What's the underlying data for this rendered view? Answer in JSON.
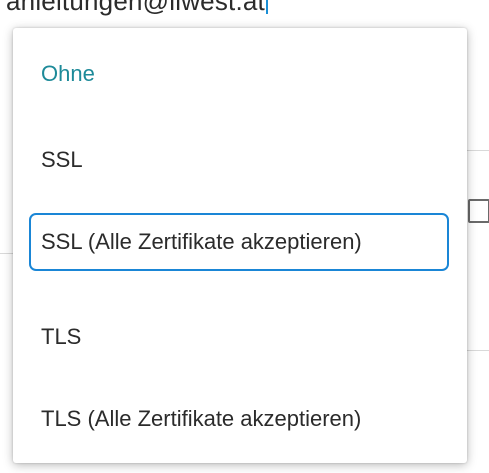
{
  "background": {
    "email_value": "anleitungen@liwest.at"
  },
  "dropdown": {
    "options": [
      {
        "label": "Ohne",
        "selected": true
      },
      {
        "label": "SSL",
        "selected": false
      },
      {
        "label": "SSL (Alle Zertifikate akzeptieren)",
        "selected": false,
        "focused": true
      },
      {
        "label": "TLS",
        "selected": false
      },
      {
        "label": "TLS (Alle Zertifikate akzeptieren)",
        "selected": false
      }
    ]
  },
  "colors": {
    "selected_text": "#1d8a99",
    "focus_ring": "#1a86d6",
    "cursor": "#1a8fd6"
  }
}
